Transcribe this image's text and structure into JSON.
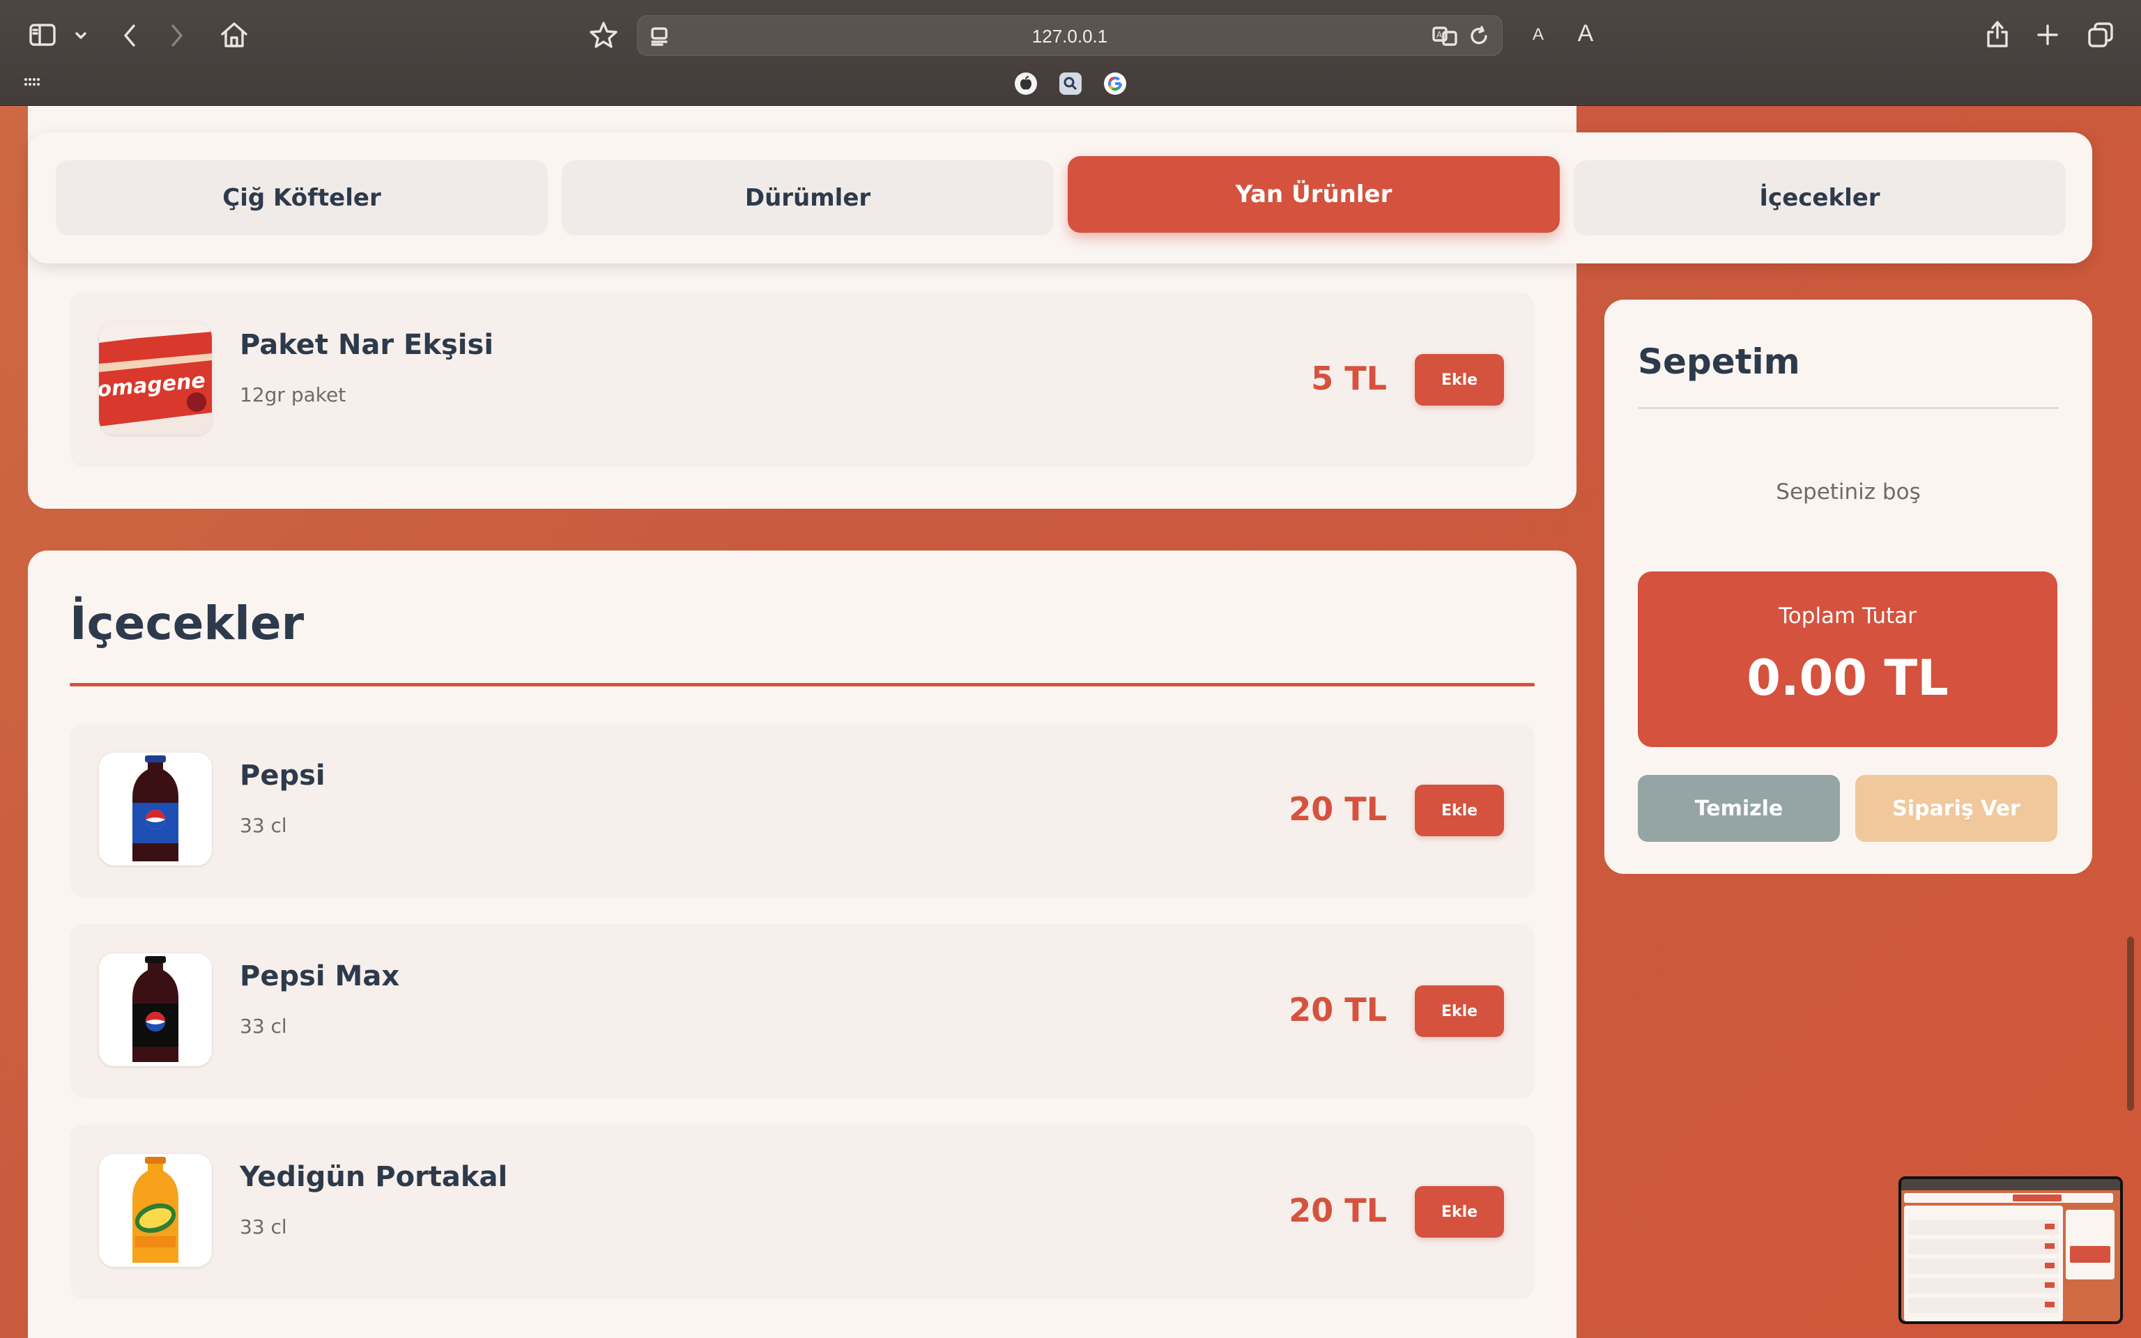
{
  "browser": {
    "url": "127.0.0.1",
    "text_size_small": "A",
    "text_size_large": "A",
    "favorites": [
      "apple-icon",
      "search-icon",
      "google-icon"
    ]
  },
  "tabs": [
    {
      "label": "Çiğ Köfteler",
      "active": false
    },
    {
      "label": "Dürümler",
      "active": false
    },
    {
      "label": "Yan Ürünler",
      "active": true
    },
    {
      "label": "İçecekler",
      "active": false
    }
  ],
  "side_products": {
    "items": [
      {
        "name": "Paket Nar Ekşisi",
        "desc": "12gr paket",
        "price": "5 TL",
        "button": "Ekle",
        "image_text": "omagene"
      }
    ]
  },
  "drinks": {
    "title": "İçecekler",
    "items": [
      {
        "name": "Pepsi",
        "desc": "33 cl",
        "price": "20 TL",
        "button": "Ekle"
      },
      {
        "name": "Pepsi Max",
        "desc": "33 cl",
        "price": "20 TL",
        "button": "Ekle"
      },
      {
        "name": "Yedigün Portakal",
        "desc": "33 cl",
        "price": "20 TL",
        "button": "Ekle"
      }
    ]
  },
  "cart": {
    "title": "Sepetim",
    "empty_text": "Sepetiniz boş",
    "total_label": "Toplam Tutar",
    "total_value": "0.00 TL",
    "clear_label": "Temizle",
    "order_label": "Sipariş Ver"
  },
  "colors": {
    "accent": "#d5523e",
    "text_dark": "#2d3a4b",
    "clear_button": "#95a5a6",
    "order_button_disabled": "#f0c89c"
  }
}
